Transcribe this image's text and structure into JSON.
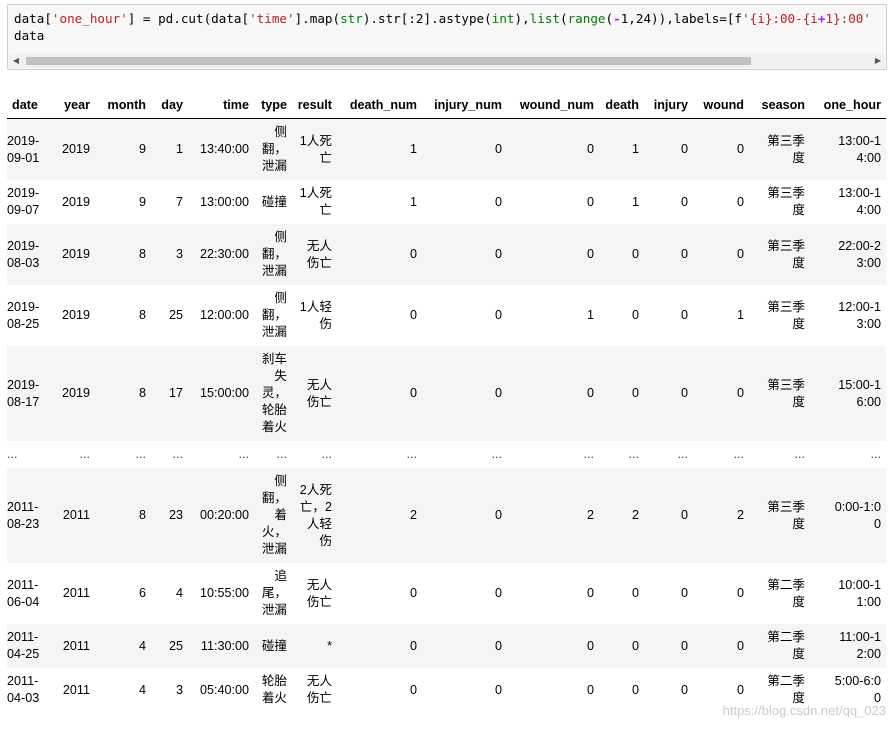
{
  "code": {
    "line1": {
      "t1": "data[",
      "s1": "'one_hour'",
      "t2": "] = pd.cut(data[",
      "s2": "'time'",
      "t3": "].map(",
      "k1": "str",
      "t4": ").str[:2].astype(",
      "k2": "int",
      "t5": "),",
      "k3": "list",
      "t6": "(",
      "k4": "range",
      "t7": "(",
      "o1": "-",
      "t8": "1,24)),labels=[f",
      "s3": "'{i}:00-{i",
      "o2": "+",
      "s4": "1}:00'"
    },
    "line2": "data"
  },
  "table": {
    "columns": [
      "date",
      "year",
      "month",
      "day",
      "time",
      "type",
      "result",
      "death_num",
      "injury_num",
      "wound_num",
      "death",
      "injury",
      "wound",
      "season",
      "one_hour"
    ],
    "rows": [
      {
        "date": "2019-09-01",
        "year": "2019",
        "month": "9",
        "day": "1",
        "time": "13:40:00",
        "type": "侧翻，泄漏",
        "result": "1人死亡",
        "death_num": "1",
        "injury_num": "0",
        "wound_num": "0",
        "death": "1",
        "injury": "0",
        "wound": "0",
        "season": "第三季度",
        "one_hour": "13:00-14:00"
      },
      {
        "date": "2019-09-07",
        "year": "2019",
        "month": "9",
        "day": "7",
        "time": "13:00:00",
        "type": "碰撞",
        "result": "1人死亡",
        "death_num": "1",
        "injury_num": "0",
        "wound_num": "0",
        "death": "1",
        "injury": "0",
        "wound": "0",
        "season": "第三季度",
        "one_hour": "13:00-14:00"
      },
      {
        "date": "2019-08-03",
        "year": "2019",
        "month": "8",
        "day": "3",
        "time": "22:30:00",
        "type": "侧翻，泄漏",
        "result": "无人伤亡",
        "death_num": "0",
        "injury_num": "0",
        "wound_num": "0",
        "death": "0",
        "injury": "0",
        "wound": "0",
        "season": "第三季度",
        "one_hour": "22:00-23:00"
      },
      {
        "date": "2019-08-25",
        "year": "2019",
        "month": "8",
        "day": "25",
        "time": "12:00:00",
        "type": "侧翻，泄漏",
        "result": "1人轻伤",
        "death_num": "0",
        "injury_num": "0",
        "wound_num": "1",
        "death": "0",
        "injury": "0",
        "wound": "1",
        "season": "第三季度",
        "one_hour": "12:00-13:00"
      },
      {
        "date": "2019-08-17",
        "year": "2019",
        "month": "8",
        "day": "17",
        "time": "15:00:00",
        "type": "刹车失灵，轮胎着火",
        "result": "无人伤亡",
        "death_num": "0",
        "injury_num": "0",
        "wound_num": "0",
        "death": "0",
        "injury": "0",
        "wound": "0",
        "season": "第三季度",
        "one_hour": "15:00-16:00"
      },
      {
        "ellipsis": "..."
      },
      {
        "date": "2011-08-23",
        "year": "2011",
        "month": "8",
        "day": "23",
        "time": "00:20:00",
        "type": "侧翻，着火，泄漏",
        "result": "2人死亡，2人轻伤",
        "death_num": "2",
        "injury_num": "0",
        "wound_num": "2",
        "death": "2",
        "injury": "0",
        "wound": "2",
        "season": "第三季度",
        "one_hour": "0:00-1:00"
      },
      {
        "date": "2011-06-04",
        "year": "2011",
        "month": "6",
        "day": "4",
        "time": "10:55:00",
        "type": "追尾，泄漏",
        "result": "无人伤亡",
        "death_num": "0",
        "injury_num": "0",
        "wound_num": "0",
        "death": "0",
        "injury": "0",
        "wound": "0",
        "season": "第二季度",
        "one_hour": "10:00-11:00"
      },
      {
        "date": "2011-04-25",
        "year": "2011",
        "month": "4",
        "day": "25",
        "time": "11:30:00",
        "type": "碰撞",
        "result": "*",
        "death_num": "0",
        "injury_num": "0",
        "wound_num": "0",
        "death": "0",
        "injury": "0",
        "wound": "0",
        "season": "第二季度",
        "one_hour": "11:00-12:00"
      },
      {
        "date": "2011-04-03",
        "year": "2011",
        "month": "4",
        "day": "3",
        "time": "05:40:00",
        "type": "轮胎着火",
        "result": "无人伤亡",
        "death_num": "0",
        "injury_num": "0",
        "wound_num": "0",
        "death": "0",
        "injury": "0",
        "wound": "0",
        "season": "第二季度",
        "one_hour": "5:00-6:00"
      }
    ]
  },
  "watermark": "https://blog.csdn.net/qq_023",
  "icons": {
    "scroll_left": "triangle-left-icon",
    "scroll_right": "triangle-right-icon"
  }
}
